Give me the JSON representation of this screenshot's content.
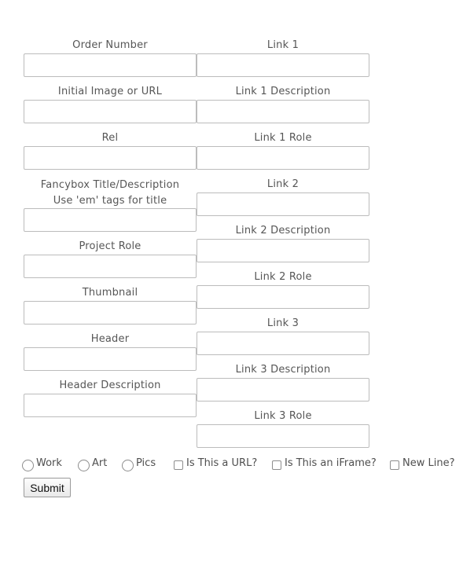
{
  "form": {
    "left_column": [
      {
        "label": "Order Number",
        "value": ""
      },
      {
        "label": "Initial Image or URL",
        "value": ""
      },
      {
        "label": "Rel",
        "value": ""
      },
      {
        "label": "Fancybox Title/Description",
        "sublabel": "Use 'em' tags for title",
        "value": ""
      },
      {
        "label": "Project Role",
        "value": ""
      },
      {
        "label": "Thumbnail",
        "value": ""
      },
      {
        "label": "Header",
        "value": ""
      },
      {
        "label": "Header Description",
        "value": ""
      }
    ],
    "right_column": [
      {
        "label": "Link 1",
        "value": ""
      },
      {
        "label": "Link 1 Description",
        "value": ""
      },
      {
        "label": "Link 1 Role",
        "value": ""
      },
      {
        "label": "Link 2",
        "value": ""
      },
      {
        "label": "Link 2 Description",
        "value": ""
      },
      {
        "label": "Link 2 Role",
        "value": ""
      },
      {
        "label": "Link 3",
        "value": ""
      },
      {
        "label": "Link 3 Description",
        "value": ""
      },
      {
        "label": "Link 3 Role",
        "value": ""
      }
    ],
    "radios": [
      {
        "label": "Work",
        "checked": false
      },
      {
        "label": "Art",
        "checked": false
      },
      {
        "label": "Pics",
        "checked": false
      }
    ],
    "checkboxes": [
      {
        "label": "Is This a URL?",
        "checked": false
      },
      {
        "label": "Is This an iFrame?",
        "checked": false
      },
      {
        "label": "New Line?",
        "checked": false
      }
    ],
    "submit_label": "Submit"
  },
  "colors": {
    "label_text": "#565656",
    "input_border": "#bcbcbc",
    "background": "#ffffff"
  }
}
